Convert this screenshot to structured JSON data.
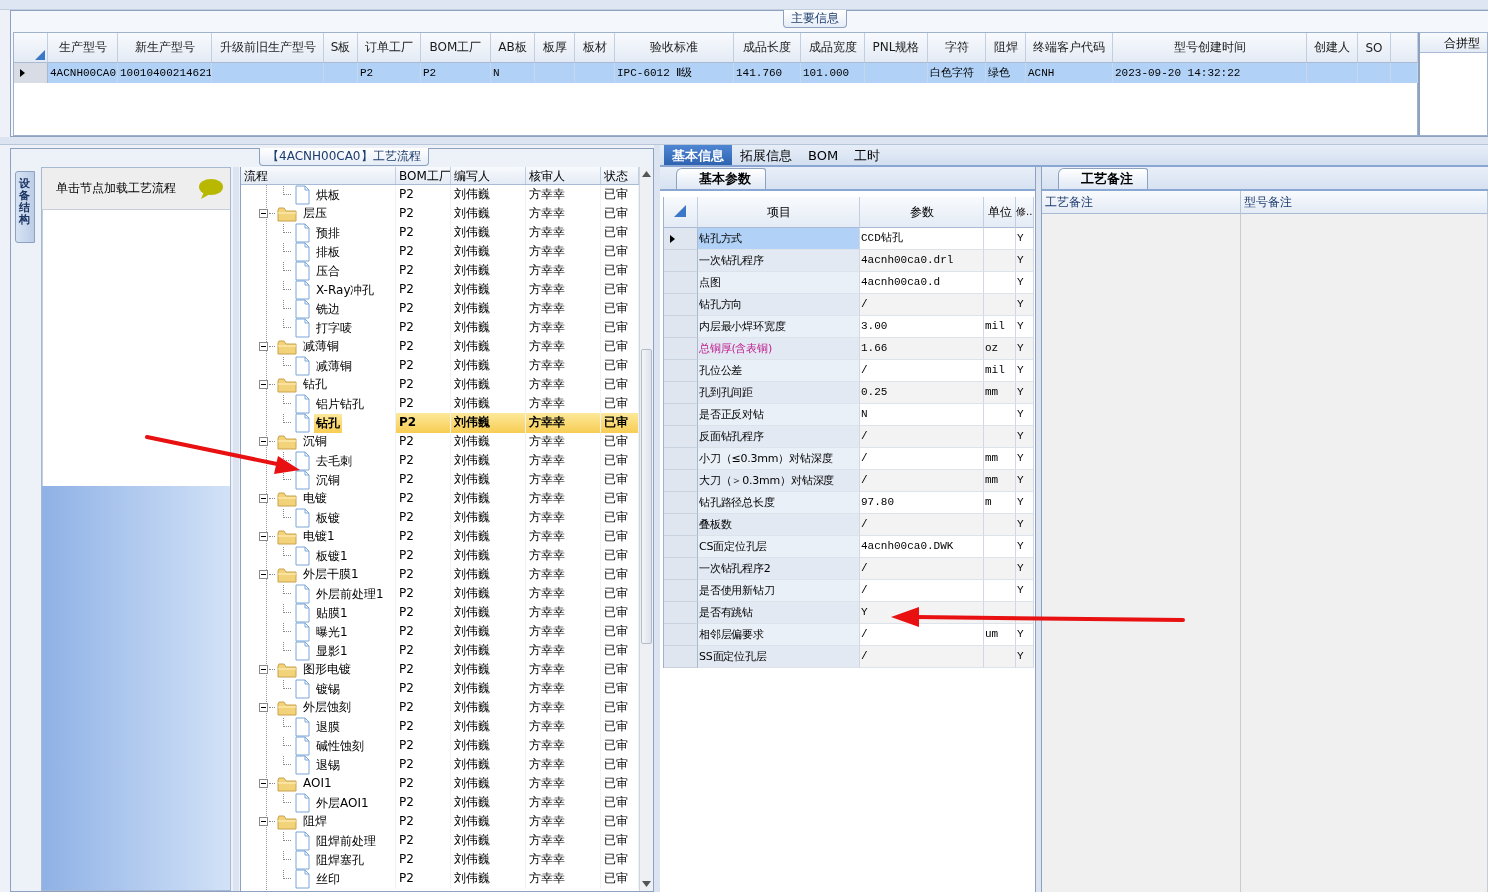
{
  "main_info": {
    "title": "主要信息",
    "columns": [
      "生产型号",
      "新生产型号",
      "升级前旧生产型号",
      "S板",
      "订单工厂",
      "BOM工厂",
      "AB板",
      "板厚",
      "板材",
      "验收标准",
      "成品长度",
      "成品宽度",
      "PNL规格",
      "字符",
      "阻焊",
      "终端客户代码",
      "型号创建时间",
      "创建人",
      "SO"
    ],
    "rows": [
      {
        "selected": true,
        "cells": [
          "4ACNH00CA0",
          "10010400214621",
          null,
          null,
          "P2",
          "P2",
          "N",
          null,
          null,
          "IPC-6012 Ⅱ级",
          "141.760",
          "101.000",
          null,
          "白色字符",
          "绿色",
          "ACNH",
          "2023-09-20 14:32:22",
          null,
          null
        ]
      }
    ],
    "side_panel": {
      "title": "合拼型"
    }
  },
  "process": {
    "title": "【4ACNH00CA0】工艺流程",
    "side_tab": "设备结构",
    "hint": "单击节点加载工艺流程",
    "headers": {
      "flow": "流程",
      "bom": "BOM工厂",
      "author": "编写人",
      "reviewer": "核审人",
      "status": "状态"
    },
    "nodes": [
      {
        "name": "烘板",
        "kind": "leaf",
        "selected": false,
        "bom": "P2",
        "author": "刘伟巍",
        "reviewer": "方幸幸",
        "status": "已审"
      },
      {
        "name": "层压",
        "kind": "folder",
        "expanded": true,
        "selected": false,
        "bom": "P2",
        "author": "刘伟巍",
        "reviewer": "方幸幸",
        "status": "已审",
        "children": [
          {
            "name": "预排",
            "kind": "leaf",
            "selected": false,
            "bom": "P2",
            "author": "刘伟巍",
            "reviewer": "方幸幸",
            "status": "已审"
          },
          {
            "name": "排板",
            "kind": "leaf",
            "selected": false,
            "bom": "P2",
            "author": "刘伟巍",
            "reviewer": "方幸幸",
            "status": "已审"
          },
          {
            "name": "压合",
            "kind": "leaf",
            "selected": false,
            "bom": "P2",
            "author": "刘伟巍",
            "reviewer": "方幸幸",
            "status": "已审"
          },
          {
            "name": "X-Ray冲孔",
            "kind": "leaf",
            "selected": false,
            "bom": "P2",
            "author": "刘伟巍",
            "reviewer": "方幸幸",
            "status": "已审"
          },
          {
            "name": "铣边",
            "kind": "leaf",
            "selected": false,
            "bom": "P2",
            "author": "刘伟巍",
            "reviewer": "方幸幸",
            "status": "已审"
          },
          {
            "name": "打字唛",
            "kind": "leaf",
            "selected": false,
            "bom": "P2",
            "author": "刘伟巍",
            "reviewer": "方幸幸",
            "status": "已审"
          }
        ]
      },
      {
        "name": "减薄铜",
        "kind": "folder",
        "expanded": true,
        "selected": false,
        "bom": "P2",
        "author": "刘伟巍",
        "reviewer": "方幸幸",
        "status": "已审",
        "children": [
          {
            "name": "减薄铜",
            "kind": "leaf",
            "selected": false,
            "bom": "P2",
            "author": "刘伟巍",
            "reviewer": "方幸幸",
            "status": "已审"
          }
        ]
      },
      {
        "name": "钻孔",
        "kind": "folder",
        "expanded": true,
        "selected": false,
        "bom": "P2",
        "author": "刘伟巍",
        "reviewer": "方幸幸",
        "status": "已审",
        "children": [
          {
            "name": "铝片钻孔",
            "kind": "leaf",
            "selected": false,
            "bom": "P2",
            "author": "刘伟巍",
            "reviewer": "方幸幸",
            "status": "已审"
          },
          {
            "name": "钻孔",
            "kind": "leaf",
            "selected": true,
            "bom": "P2",
            "author": "刘伟巍",
            "reviewer": "方幸幸",
            "status": "已审"
          }
        ]
      },
      {
        "name": "沉铜",
        "kind": "folder",
        "expanded": true,
        "selected": false,
        "bom": "P2",
        "author": "刘伟巍",
        "reviewer": "方幸幸",
        "status": "已审",
        "children": [
          {
            "name": "去毛刺",
            "kind": "leaf",
            "selected": false,
            "bom": "P2",
            "author": "刘伟巍",
            "reviewer": "方幸幸",
            "status": "已审"
          },
          {
            "name": "沉铜",
            "kind": "leaf",
            "selected": false,
            "bom": "P2",
            "author": "刘伟巍",
            "reviewer": "方幸幸",
            "status": "已审"
          }
        ]
      },
      {
        "name": "电镀",
        "kind": "folder",
        "expanded": true,
        "selected": false,
        "bom": "P2",
        "author": "刘伟巍",
        "reviewer": "方幸幸",
        "status": "已审",
        "children": [
          {
            "name": "板镀",
            "kind": "leaf",
            "selected": false,
            "bom": "P2",
            "author": "刘伟巍",
            "reviewer": "方幸幸",
            "status": "已审"
          }
        ]
      },
      {
        "name": "电镀1",
        "kind": "folder",
        "expanded": true,
        "selected": false,
        "bom": "P2",
        "author": "刘伟巍",
        "reviewer": "方幸幸",
        "status": "已审",
        "children": [
          {
            "name": "板镀1",
            "kind": "leaf",
            "selected": false,
            "bom": "P2",
            "author": "刘伟巍",
            "reviewer": "方幸幸",
            "status": "已审"
          }
        ]
      },
      {
        "name": "外层干膜1",
        "kind": "folder",
        "expanded": true,
        "selected": false,
        "bom": "P2",
        "author": "刘伟巍",
        "reviewer": "方幸幸",
        "status": "已审",
        "children": [
          {
            "name": "外层前处理1",
            "kind": "leaf",
            "selected": false,
            "bom": "P2",
            "author": "刘伟巍",
            "reviewer": "方幸幸",
            "status": "已审"
          },
          {
            "name": "贴膜1",
            "kind": "leaf",
            "selected": false,
            "bom": "P2",
            "author": "刘伟巍",
            "reviewer": "方幸幸",
            "status": "已审"
          },
          {
            "name": "曝光1",
            "kind": "leaf",
            "selected": false,
            "bom": "P2",
            "author": "刘伟巍",
            "reviewer": "方幸幸",
            "status": "已审"
          },
          {
            "name": "显影1",
            "kind": "leaf",
            "selected": false,
            "bom": "P2",
            "author": "刘伟巍",
            "reviewer": "方幸幸",
            "status": "已审"
          }
        ]
      },
      {
        "name": "图形电镀",
        "kind": "folder",
        "expanded": true,
        "selected": false,
        "bom": "P2",
        "author": "刘伟巍",
        "reviewer": "方幸幸",
        "status": "已审",
        "children": [
          {
            "name": "镀锡",
            "kind": "leaf",
            "selected": false,
            "bom": "P2",
            "author": "刘伟巍",
            "reviewer": "方幸幸",
            "status": "已审"
          }
        ]
      },
      {
        "name": "外层蚀刻",
        "kind": "folder",
        "expanded": true,
        "selected": false,
        "bom": "P2",
        "author": "刘伟巍",
        "reviewer": "方幸幸",
        "status": "已审",
        "children": [
          {
            "name": "退膜",
            "kind": "leaf",
            "selected": false,
            "bom": "P2",
            "author": "刘伟巍",
            "reviewer": "方幸幸",
            "status": "已审"
          },
          {
            "name": "碱性蚀刻",
            "kind": "leaf",
            "selected": false,
            "bom": "P2",
            "author": "刘伟巍",
            "reviewer": "方幸幸",
            "status": "已审"
          },
          {
            "name": "退锡",
            "kind": "leaf",
            "selected": false,
            "bom": "P2",
            "author": "刘伟巍",
            "reviewer": "方幸幸",
            "status": "已审"
          }
        ]
      },
      {
        "name": "AOI1",
        "kind": "folder",
        "expanded": true,
        "selected": false,
        "bom": "P2",
        "author": "刘伟巍",
        "reviewer": "方幸幸",
        "status": "已审",
        "children": [
          {
            "name": "外层AOI1",
            "kind": "leaf",
            "selected": false,
            "bom": "P2",
            "author": "刘伟巍",
            "reviewer": "方幸幸",
            "status": "已审"
          }
        ]
      },
      {
        "name": "阻焊",
        "kind": "folder",
        "expanded": true,
        "selected": false,
        "bom": "P2",
        "author": "刘伟巍",
        "reviewer": "方幸幸",
        "status": "已审",
        "children": [
          {
            "name": "阻焊前处理",
            "kind": "leaf",
            "selected": false,
            "bom": "P2",
            "author": "刘伟巍",
            "reviewer": "方幸幸",
            "status": "已审"
          },
          {
            "name": "阻焊塞孔",
            "kind": "leaf",
            "selected": false,
            "bom": "P2",
            "author": "刘伟巍",
            "reviewer": "方幸幸",
            "status": "已审"
          },
          {
            "name": "丝印",
            "kind": "leaf",
            "selected": false,
            "bom": "P2",
            "author": "刘伟巍",
            "reviewer": "方幸幸",
            "status": "已审"
          }
        ]
      }
    ]
  },
  "detail": {
    "tabs": [
      {
        "label": "基本信息",
        "selected": true
      },
      {
        "label": "拓展信息",
        "selected": false
      },
      {
        "label": "BOM",
        "selected": false
      },
      {
        "label": "工时",
        "selected": false
      }
    ],
    "sub_tab": "基本参数",
    "columns": [
      "项目",
      "参数",
      "单位",
      "修.."
    ],
    "rows": [
      {
        "item": "钻孔方式",
        "value": "CCD钻孔",
        "flag": "Y",
        "selected": true,
        "emphasized": false
      },
      {
        "item": "一次钻孔程序",
        "value": "4acnh00ca0.drl",
        "flag": "Y",
        "selected": false,
        "emphasized": false
      },
      {
        "item": "点图",
        "value": "4acnh00ca0.d",
        "flag": "Y",
        "selected": false,
        "emphasized": false
      },
      {
        "item": "钻孔方向",
        "value": "/",
        "flag": "Y",
        "selected": false,
        "emphasized": false
      },
      {
        "item": "内层最小焊环宽度",
        "value": "3.00",
        "unit": "mil",
        "flag": "Y",
        "selected": false,
        "emphasized": false
      },
      {
        "item": "总铜厚(含表铜)",
        "value": "1.66",
        "unit": "oz",
        "flag": "Y",
        "selected": false,
        "emphasized": true
      },
      {
        "item": "孔位公差",
        "value": "/",
        "unit": "mil",
        "flag": "Y",
        "selected": false,
        "emphasized": false
      },
      {
        "item": "孔到孔间距",
        "value": "0.25",
        "unit": "mm",
        "flag": "Y",
        "selected": false,
        "emphasized": false
      },
      {
        "item": "是否正反对钻",
        "value": "N",
        "flag": "Y",
        "selected": false,
        "emphasized": false
      },
      {
        "item": "反面钻孔程序",
        "value": "/",
        "flag": "Y",
        "selected": false,
        "emphasized": false
      },
      {
        "item": "小刀（≤0.3mm）对钻深度",
        "value": "/",
        "unit": "mm",
        "flag": "Y",
        "selected": false,
        "emphasized": false
      },
      {
        "item": "大刀（＞0.3mm）对钻深度",
        "value": "/",
        "unit": "mm",
        "flag": "Y",
        "selected": false,
        "emphasized": false
      },
      {
        "item": "钻孔路径总长度",
        "value": "97.80",
        "unit": "m",
        "flag": "Y",
        "selected": false,
        "emphasized": false
      },
      {
        "item": "叠板数",
        "value": "/",
        "flag": "Y",
        "selected": false,
        "emphasized": false
      },
      {
        "item": "CS面定位孔层",
        "value": "4acnh00ca0.DWK",
        "flag": "Y",
        "selected": false,
        "emphasized": false
      },
      {
        "item": "一次钻孔程序2",
        "value": "/",
        "flag": "Y",
        "selected": false,
        "emphasized": false
      },
      {
        "item": "是否使用新钻刀",
        "value": "/",
        "flag": "Y",
        "selected": false,
        "emphasized": false
      },
      {
        "item": "是否有跳钻",
        "value": "Y",
        "selected": false,
        "emphasized": false
      },
      {
        "item": "相邻层偏要求",
        "value": "/",
        "unit": "um",
        "flag": "Y",
        "selected": false,
        "emphasized": false
      },
      {
        "item": "SS面定位孔层",
        "value": "/",
        "flag": "Y",
        "selected": false,
        "emphasized": false
      }
    ]
  },
  "notes": {
    "tab": "工艺备注",
    "columns": [
      "工艺备注",
      "型号备注"
    ]
  }
}
